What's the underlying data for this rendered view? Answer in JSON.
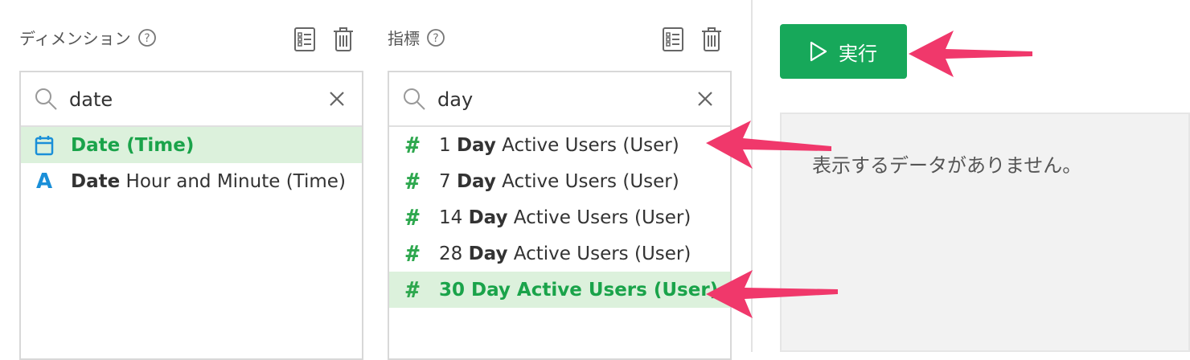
{
  "dimensions": {
    "title": "ディメンション",
    "search_value": "date",
    "items": [
      {
        "highlight": "Date",
        "rest": " (Time)",
        "icon": "calendar-icon",
        "selected": true
      },
      {
        "highlight": "Date",
        "rest": " Hour and Minute (Time)",
        "icon": "text-type-icon",
        "selected": false
      }
    ]
  },
  "metrics": {
    "title": "指標",
    "search_value": "day",
    "items": [
      {
        "prefix": "1 ",
        "highlight": "Day",
        "rest": " Active Users (User)",
        "icon": "hash-icon",
        "selected": false
      },
      {
        "prefix": "7 ",
        "highlight": "Day",
        "rest": " Active Users (User)",
        "icon": "hash-icon",
        "selected": false
      },
      {
        "prefix": "14 ",
        "highlight": "Day",
        "rest": " Active Users (User)",
        "icon": "hash-icon",
        "selected": false
      },
      {
        "prefix": "28 ",
        "highlight": "Day",
        "rest": " Active Users (User)",
        "icon": "hash-icon",
        "selected": false
      },
      {
        "prefix": "30 ",
        "highlight": "Day",
        "rest": " Active Users (User)",
        "icon": "hash-icon",
        "selected": true
      }
    ]
  },
  "run_button": {
    "label": "実行",
    "icon": "play-icon"
  },
  "result": {
    "empty_message": "表示するデータがありません。"
  },
  "colors": {
    "accent": "#17a85a",
    "selected_bg": "#dcf1dc",
    "arrow": "#f0386b",
    "hash": "#2fa84f",
    "calendar": "#1a8fd8"
  }
}
